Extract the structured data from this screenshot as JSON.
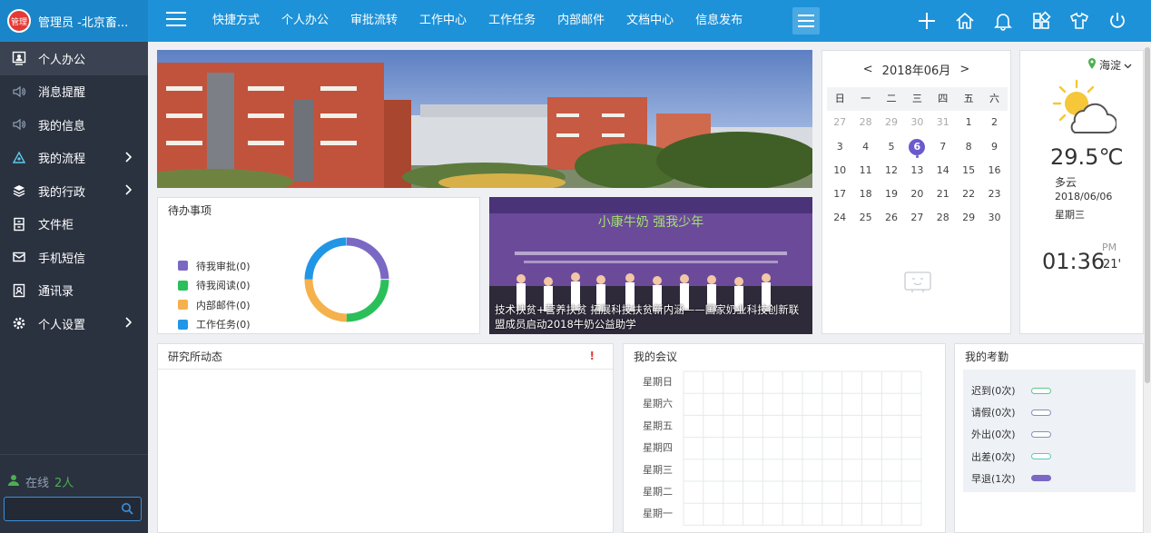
{
  "brand": {
    "logo_text": "管理",
    "user": "管理员 -北京畜..."
  },
  "nav": {
    "items": [
      "快捷方式",
      "个人办公",
      "审批流转",
      "工作中心",
      "工作任务",
      "内部邮件",
      "文档中心",
      "信息发布"
    ],
    "right_icons": [
      "plus-icon",
      "home-icon",
      "bell-icon",
      "apps-icon",
      "shirt-icon",
      "power-icon"
    ]
  },
  "sidebar": {
    "items": [
      {
        "label": "个人办公",
        "icon": "person-icon",
        "active": true,
        "has_children": false
      },
      {
        "label": "消息提醒",
        "icon": "speaker-icon",
        "active": false,
        "has_children": false
      },
      {
        "label": "我的信息",
        "icon": "speaker-icon",
        "active": false,
        "has_children": false
      },
      {
        "label": "我的流程",
        "icon": "flow-icon",
        "active": false,
        "has_children": true
      },
      {
        "label": "我的行政",
        "icon": "layers-icon",
        "active": false,
        "has_children": true
      },
      {
        "label": "文件柜",
        "icon": "cabinet-icon",
        "active": false,
        "has_children": false
      },
      {
        "label": "手机短信",
        "icon": "envelope-icon",
        "active": false,
        "has_children": false
      },
      {
        "label": "通讯录",
        "icon": "contacts-icon",
        "active": false,
        "has_children": false
      },
      {
        "label": "个人设置",
        "icon": "gear-icon",
        "active": false,
        "has_children": true
      }
    ],
    "online_label": "在线",
    "online_count": "2人",
    "search_placeholder": ""
  },
  "todo": {
    "title": "待办事项",
    "items": [
      {
        "label": "待我审批(0)",
        "color": "#7b68c4"
      },
      {
        "label": "待我阅读(0)",
        "color": "#2bbf5a"
      },
      {
        "label": "内部邮件(0)",
        "color": "#f5b14c"
      },
      {
        "label": "工作任务(0)",
        "color": "#2196e6"
      }
    ]
  },
  "news": {
    "caption": "技术扶贫+营养扶贫 拓展科技扶贫新内涵——国家奶业科技创新联盟成员启动2018牛奶公益助学"
  },
  "calendar": {
    "month_label": "2018年06月",
    "prev": "<",
    "next": ">",
    "weekdays": [
      "日",
      "一",
      "二",
      "三",
      "四",
      "五",
      "六"
    ],
    "weeks": [
      [
        "27",
        "28",
        "29",
        "30",
        "31",
        "1",
        "2"
      ],
      [
        "3",
        "4",
        "5",
        "6",
        "7",
        "8",
        "9"
      ],
      [
        "10",
        "11",
        "12",
        "13",
        "14",
        "15",
        "16"
      ],
      [
        "17",
        "18",
        "19",
        "20",
        "21",
        "22",
        "23"
      ],
      [
        "24",
        "25",
        "26",
        "27",
        "28",
        "29",
        "30"
      ]
    ],
    "today": "6"
  },
  "weather": {
    "location": "海淀",
    "temperature": "29.5℃",
    "description": "多云",
    "date": "2018/06/06",
    "weekday": "星期三",
    "time": "01:36",
    "ampm": "PM",
    "seconds": "21'"
  },
  "dynamics": {
    "title": "研究所动态",
    "alert": "!"
  },
  "meetings": {
    "title": "我的会议",
    "days": [
      "星期日",
      "星期六",
      "星期五",
      "星期四",
      "星期三",
      "星期二",
      "星期一"
    ]
  },
  "attendance": {
    "title": "我的考勤",
    "items": [
      {
        "label": "迟到(0次)",
        "color": "#5cc98a",
        "filled": false
      },
      {
        "label": "请假(0次)",
        "color": "#8a8fb5",
        "filled": false
      },
      {
        "label": "外出(0次)",
        "color": "#8a8fb5",
        "filled": false
      },
      {
        "label": "出差(0次)",
        "color": "#5cc8c8",
        "filled": false
      },
      {
        "label": "早退(1次)",
        "color": "#7b68c4",
        "filled": true
      }
    ]
  }
}
